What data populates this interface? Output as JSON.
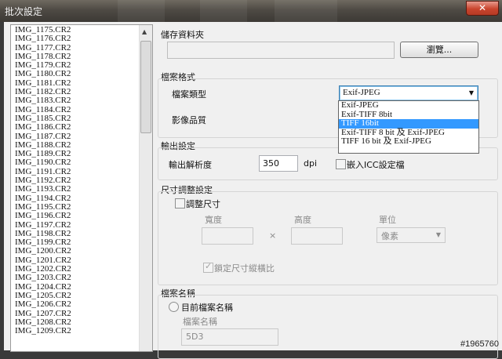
{
  "window": {
    "title": "批次設定",
    "close_glyph": "✕"
  },
  "file_list": {
    "items": [
      "IMG_1175.CR2",
      "IMG_1176.CR2",
      "IMG_1177.CR2",
      "IMG_1178.CR2",
      "IMG_1179.CR2",
      "IMG_1180.CR2",
      "IMG_1181.CR2",
      "IMG_1182.CR2",
      "IMG_1183.CR2",
      "IMG_1184.CR2",
      "IMG_1185.CR2",
      "IMG_1186.CR2",
      "IMG_1187.CR2",
      "IMG_1188.CR2",
      "IMG_1189.CR2",
      "IMG_1190.CR2",
      "IMG_1191.CR2",
      "IMG_1192.CR2",
      "IMG_1193.CR2",
      "IMG_1194.CR2",
      "IMG_1195.CR2",
      "IMG_1196.CR2",
      "IMG_1197.CR2",
      "IMG_1198.CR2",
      "IMG_1199.CR2",
      "IMG_1200.CR2",
      "IMG_1201.CR2",
      "IMG_1202.CR2",
      "IMG_1203.CR2",
      "IMG_1204.CR2",
      "IMG_1205.CR2",
      "IMG_1206.CR2",
      "IMG_1207.CR2",
      "IMG_1208.CR2",
      "IMG_1209.CR2"
    ]
  },
  "save_folder": {
    "header": "儲存資料夾",
    "path": "",
    "browse_label": "瀏覽..."
  },
  "file_format": {
    "header": "檔案格式",
    "type_label": "檔案類型",
    "type_value": "Exif-JPEG",
    "options": [
      "Exif-JPEG",
      "Exif-TIFF 8bit",
      "TIFF 16bit",
      "Exif-TIFF 8 bit 及 Exif-JPEG",
      "TIFF 16 bit 及 Exif-JPEG"
    ],
    "highlighted_index": 2,
    "quality_label": "影像品質"
  },
  "output": {
    "header": "輸出設定",
    "resolution_label": "輸出解析度",
    "resolution_value": "350",
    "resolution_unit": "dpi",
    "embed_icc_label": "嵌入ICC設定檔",
    "embed_icc_checked": false
  },
  "resize": {
    "header": "尺寸調整設定",
    "resize_label": "調整尺寸",
    "resize_checked": false,
    "width_label": "寬度",
    "height_label": "高度",
    "unit_label": "單位",
    "times_glyph": "×",
    "unit_value": "像素",
    "lock_label": "鎖定尺寸縱橫比",
    "lock_checked": true
  },
  "file_name": {
    "header": "檔案名稱",
    "current_name_label": "目前檔案名稱",
    "name_label": "檔案名稱",
    "name_value": "5D3"
  },
  "watermark": "#1965760"
}
